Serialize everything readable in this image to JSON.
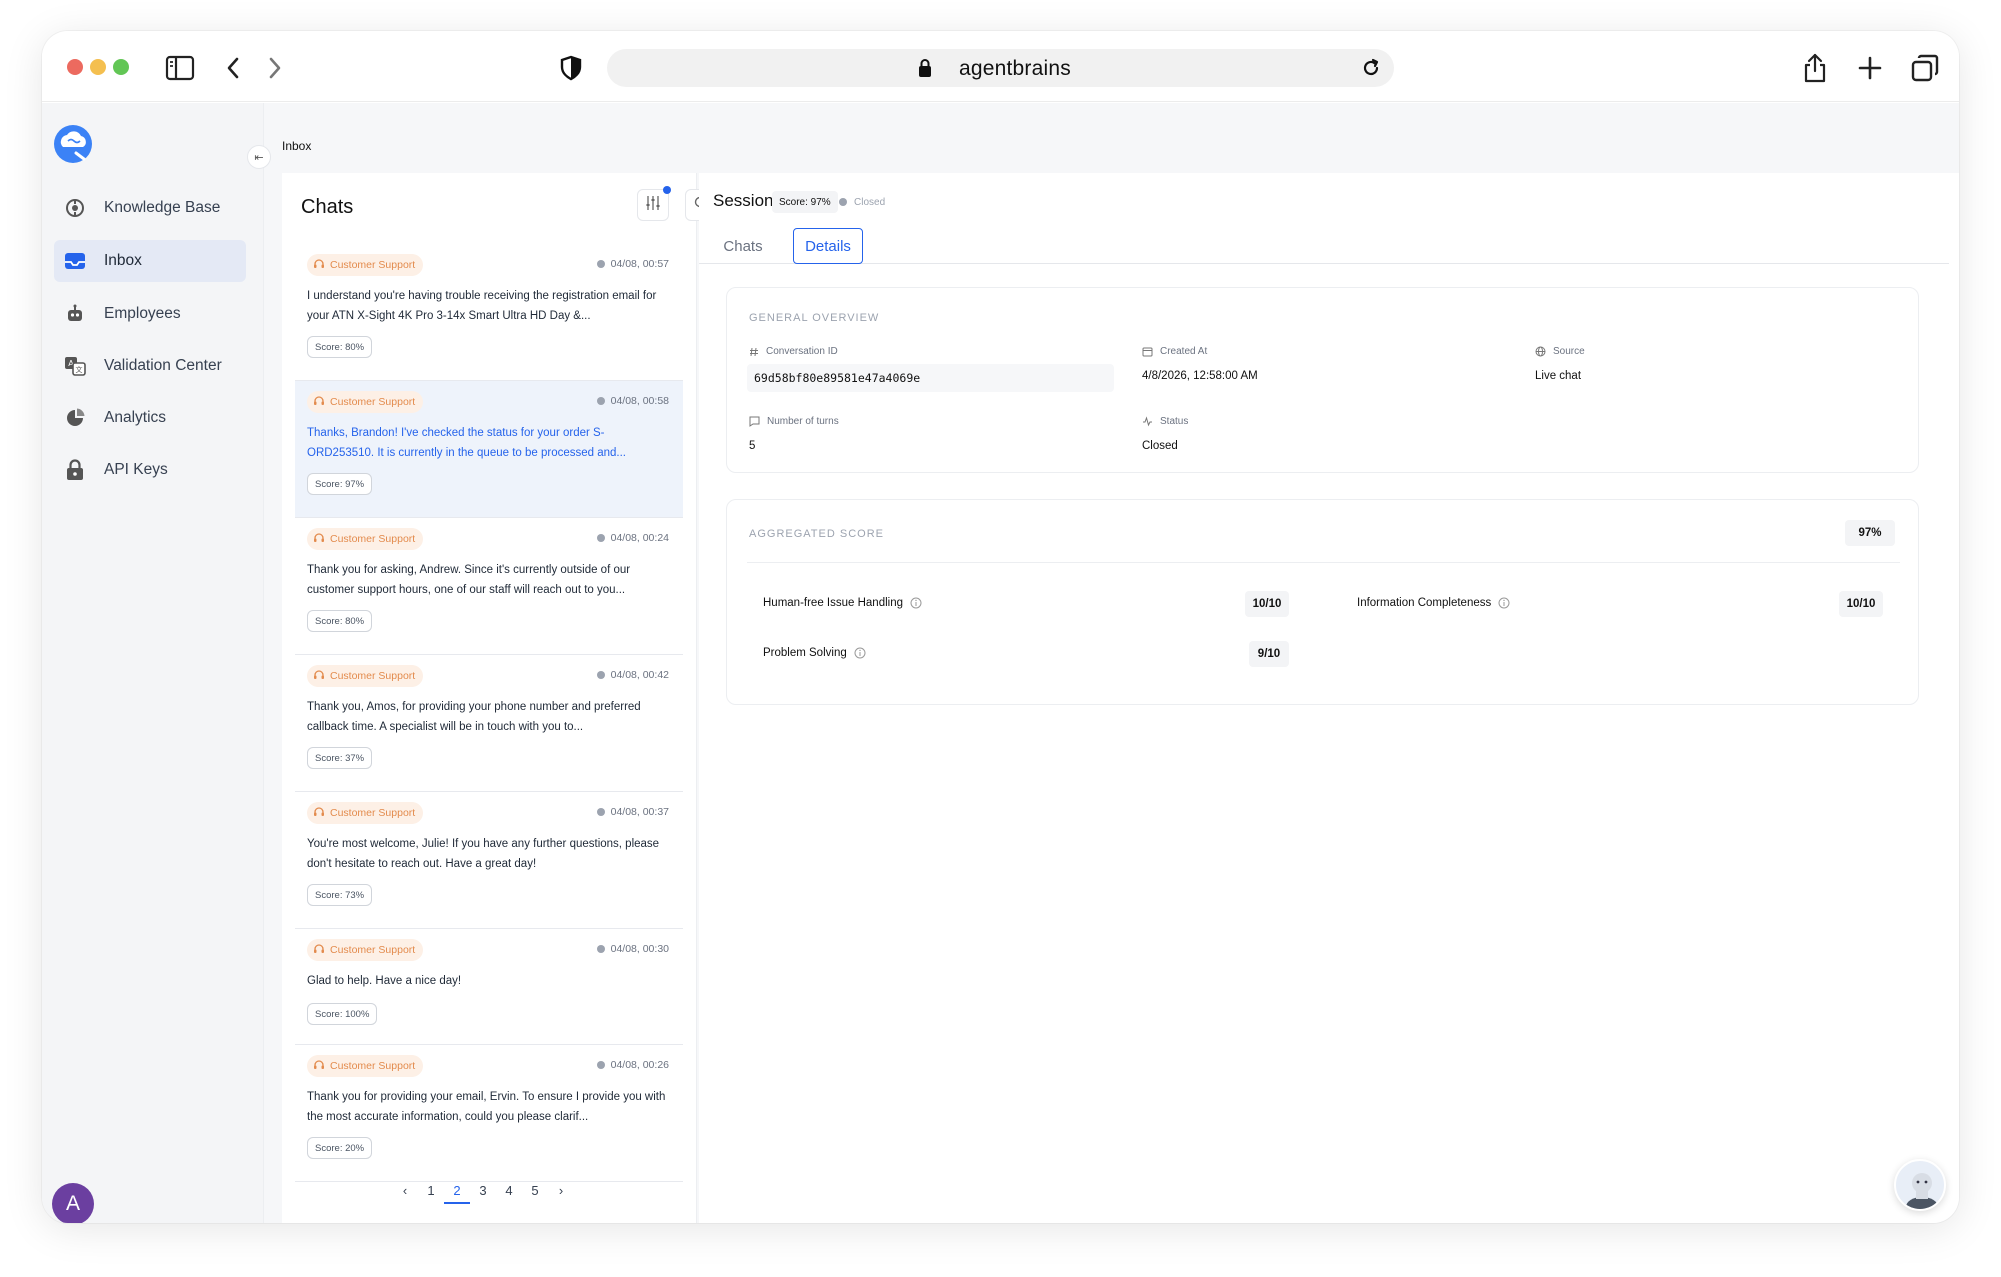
{
  "browser": {
    "url": "agentbrains"
  },
  "sidebar": {
    "items": [
      {
        "label": "Knowledge Base",
        "icon": "knowledge-base-icon"
      },
      {
        "label": "Inbox",
        "icon": "inbox-icon",
        "active": true
      },
      {
        "label": "Employees",
        "icon": "robot-icon"
      },
      {
        "label": "Validation Center",
        "icon": "translate-icon"
      },
      {
        "label": "Analytics",
        "icon": "pie-chart-icon"
      },
      {
        "label": "API Keys",
        "icon": "lock-icon"
      }
    ],
    "avatar_initial": "A"
  },
  "breadcrumb": "Inbox",
  "chats": {
    "title": "Chats",
    "items": [
      {
        "tag": "Customer Support",
        "time": "04/08, 00:57",
        "message": "I understand you're having trouble receiving the registration email for your ATN X-Sight 4K Pro 3-14x Smart Ultra HD Day &...",
        "score": "Score: 80%"
      },
      {
        "tag": "Customer Support",
        "time": "04/08, 00:58",
        "message": "Thanks, Brandon! I've checked the status for your order S-ORD253510. It is currently in the queue to be processed and...",
        "score": "Score: 97%"
      },
      {
        "tag": "Customer Support",
        "time": "04/08, 00:24",
        "message": "Thank you for asking, Andrew. Since it's currently outside of our customer support hours, one of our staff will reach out to you...",
        "score": "Score: 80%"
      },
      {
        "tag": "Customer Support",
        "time": "04/08, 00:42",
        "message": "Thank you, Amos, for providing your phone number and preferred callback time. A specialist will be in touch with you to...",
        "score": "Score: 37%"
      },
      {
        "tag": "Customer Support",
        "time": "04/08, 00:37",
        "message": "You're most welcome, Julie! If you have any further questions, please don't hesitate to reach out. Have a great day!",
        "score": "Score: 73%"
      },
      {
        "tag": "Customer Support",
        "time": "04/08, 00:30",
        "message": "Glad to help. Have a nice day!",
        "score": "Score: 100%"
      },
      {
        "tag": "Customer Support",
        "time": "04/08, 00:26",
        "message": "Thank you for providing your email, Ervin. To ensure I provide you with the most accurate information, could you please clarif...",
        "score": "Score: 20%"
      }
    ],
    "pagination": {
      "pages": [
        "1",
        "2",
        "3",
        "4",
        "5"
      ],
      "current": "2"
    }
  },
  "session": {
    "title": "Session",
    "score": "Score: 97%",
    "status": "Closed",
    "tabs": [
      "Chats",
      "Details"
    ],
    "active_tab": "Details",
    "general": {
      "heading": "GENERAL OVERVIEW",
      "conversation_id_label": "Conversation ID",
      "conversation_id": "69d58bf80e89581e47a4069e",
      "created_at_label": "Created At",
      "created_at": "4/8/2026, 12:58:00 AM",
      "source_label": "Source",
      "source": "Live chat",
      "turns_label": "Number of turns",
      "turns": "5",
      "status_label": "Status",
      "status": "Closed"
    },
    "aggregated": {
      "heading": "AGGREGATED SCORE",
      "total": "97%",
      "criteria": [
        {
          "label": "Human-free Issue Handling",
          "score": "10/10"
        },
        {
          "label": "Information Completeness",
          "score": "10/10"
        },
        {
          "label": "Problem Solving",
          "score": "9/10"
        }
      ]
    }
  }
}
